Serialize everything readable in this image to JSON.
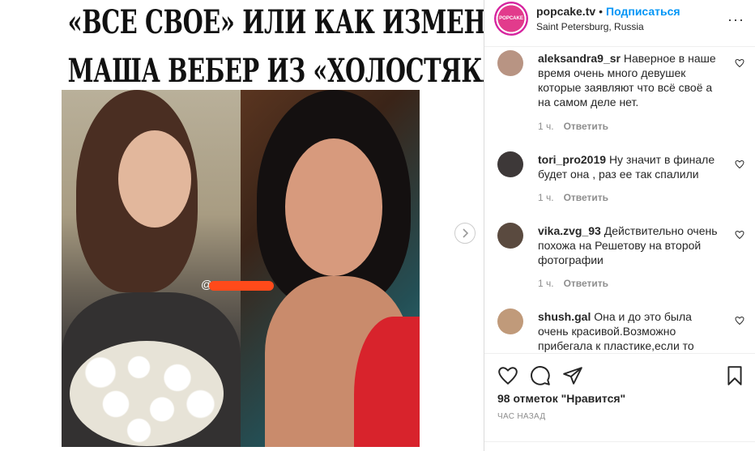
{
  "post_image": {
    "headline_line1": "«ВСЕ СВОЕ» ИЛИ КАК ИЗМЕНИЛАСЬ",
    "headline_line2": "МАША ВЕБЕР ИЗ «ХОЛОСТЯКА»",
    "watermark_prefix": "@"
  },
  "header": {
    "username": "popcake.tv",
    "separator": "•",
    "follow_label": "Подписаться",
    "location": "Saint Petersburg, Russia",
    "avatar_text": "POPCAKE",
    "more_label": "···"
  },
  "comments": [
    {
      "user": "aleksandra9_sr",
      "text": "Наверное в наше время очень много девушек которые заявляют что всё своё а на самом деле нет.",
      "time": "1 ч.",
      "reply": "Ответить"
    },
    {
      "user": "tori_pro2019",
      "text": "Ну значит в финале будет она , раз ее так спалили",
      "time": "1 ч.",
      "reply": "Ответить"
    },
    {
      "user": "vika.zvg_93",
      "text": "Действительно очень похожа на Решетову на второй фотографии",
      "time": "1 ч.",
      "reply": "Ответить"
    },
    {
      "user": "shush.gal",
      "text": "Она и до это была очень красивой.Возможно прибегала к пластике,если то",
      "time": "",
      "reply": ""
    }
  ],
  "actions": {
    "likes": "98 отметок \"Нравится\"",
    "time_ago": "ЧАС НАЗАД"
  },
  "colors": {
    "accent": "#0095f6",
    "brand_avatar": "#e23b8c",
    "redaction": "#ff4a1a"
  }
}
